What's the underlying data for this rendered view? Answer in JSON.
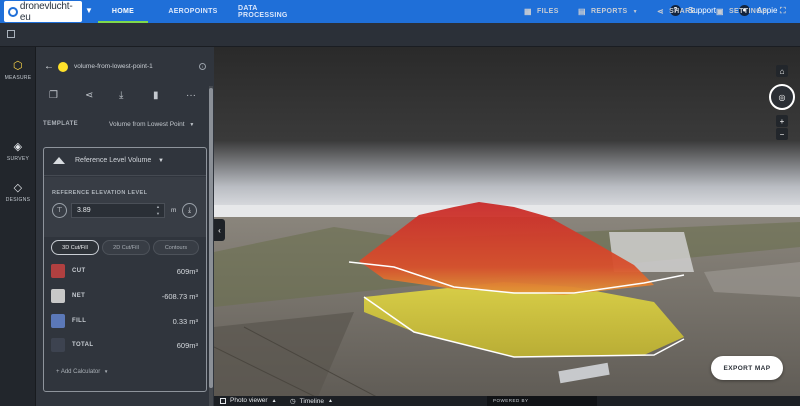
{
  "nav": {
    "logo_text": "dronevlucht-eu",
    "tabs": [
      "HOME",
      "AEROPOINTS",
      "DATA PROCESSING"
    ],
    "support_label": "Support",
    "user_label": "Appie"
  },
  "toolbar": {
    "files": "FILES",
    "reports": "REPORTS",
    "share": "SHARE",
    "settings": "SETTINGS"
  },
  "rail": {
    "measure": "MEASURE",
    "survey": "SURVEY",
    "designs": "DESIGNS"
  },
  "panel": {
    "measurement_name": "volume-from-lowest-point-1",
    "template_label": "TEMPLATE",
    "template_value": "Volume from Lowest Point"
  },
  "card": {
    "title": "Reference Level Volume",
    "ref_label": "REFERENCE ELEVATION LEVEL",
    "ref_value": "3.89",
    "unit": "m",
    "pills": [
      "3D Cut/Fill",
      "2D Cut/Fill",
      "Contours"
    ],
    "rows": [
      {
        "label": "CUT",
        "value": "609m³",
        "color": "#b04040"
      },
      {
        "label": "NET",
        "value": "-608.73 m³",
        "color": "#c8c8c8"
      },
      {
        "label": "FILL",
        "value": "0.33 m³",
        "color": "#5b78b8"
      },
      {
        "label": "TOTAL",
        "value": "609m³",
        "color": "#3d4350"
      }
    ],
    "add_calculator": "+ Add Calculator"
  },
  "map": {
    "export_label": "EXPORT MAP",
    "photo_viewer": "Photo viewer",
    "timeline": "Timeline",
    "powered_by": "POWERED BY"
  },
  "colors": {
    "accent": "#1f6fd8",
    "active_tab_underline": "#7fd94b",
    "measure_dot": "#ffe12a"
  }
}
